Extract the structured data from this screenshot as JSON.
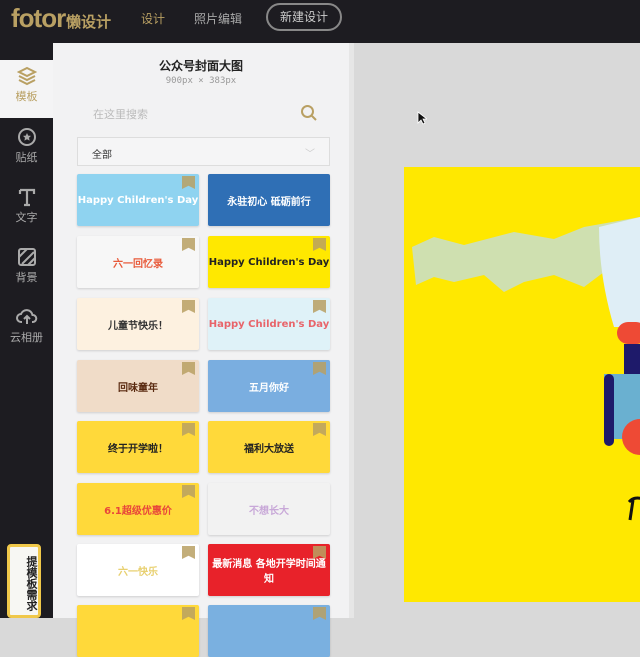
{
  "header": {
    "logo": "fotor",
    "logo_sub": "懒设计",
    "nav": [
      "设计",
      "照片编辑"
    ],
    "new_design": "新建设计"
  },
  "sidebar": {
    "items": [
      {
        "label": "模板",
        "icon": "layers-icon"
      },
      {
        "label": "贴纸",
        "icon": "star-circle-icon"
      },
      {
        "label": "文字",
        "icon": "text-icon"
      },
      {
        "label": "背景",
        "icon": "stripes-icon"
      },
      {
        "label": "云相册",
        "icon": "cloud-upload-icon"
      }
    ],
    "request_button": "提模板需求"
  },
  "panel": {
    "title": "公众号封面大图",
    "size": "900px × 383px",
    "search_placeholder": "在这里搜索",
    "category": "全部"
  },
  "templates": [
    {
      "text": "Happy Children's Day",
      "bg": "#8fd3f0",
      "fg": "#fff"
    },
    {
      "text": "永驻初心 砥砺前行",
      "bg": "#2f6fb5",
      "fg": "#fff"
    },
    {
      "text": "六一回忆录",
      "bg": "#f7f7f7",
      "fg": "#e85a3a"
    },
    {
      "text": "Happy Children's Day",
      "bg": "#ffe800",
      "fg": "#222"
    },
    {
      "text": "儿童节快乐！",
      "bg": "#fdf1e0",
      "fg": "#333"
    },
    {
      "text": "Happy Children's Day",
      "bg": "#dff2f8",
      "fg": "#e8646a"
    },
    {
      "text": "回味童年",
      "bg": "#f0dcc8",
      "fg": "#5a2a10"
    },
    {
      "text": "五月你好",
      "bg": "#7aaee0",
      "fg": "#fff"
    },
    {
      "text": "终于开学啦！",
      "bg": "#ffd93a",
      "fg": "#222"
    },
    {
      "text": "福利大放送",
      "bg": "#ffd93a",
      "fg": "#222"
    },
    {
      "text": "6.1超级优惠价",
      "bg": "#ffd93a",
      "fg": "#e8463a"
    },
    {
      "text": "不想长大",
      "bg": "#f2f2f2",
      "fg": "#c8a8d8"
    },
    {
      "text": "六一快乐",
      "bg": "#ffffff",
      "fg": "#e8d070"
    },
    {
      "text": "最新消息 各地开学时间通知",
      "bg": "#e8222a",
      "fg": "#fff"
    },
    {
      "text": "",
      "bg": "#ffd93a",
      "fg": "#222"
    },
    {
      "text": "",
      "bg": "#7ab0e0",
      "fg": "#222"
    }
  ],
  "colors": {
    "accent": "#b9a063",
    "dark": "#1d1c21",
    "canvas": "#ffe800"
  }
}
